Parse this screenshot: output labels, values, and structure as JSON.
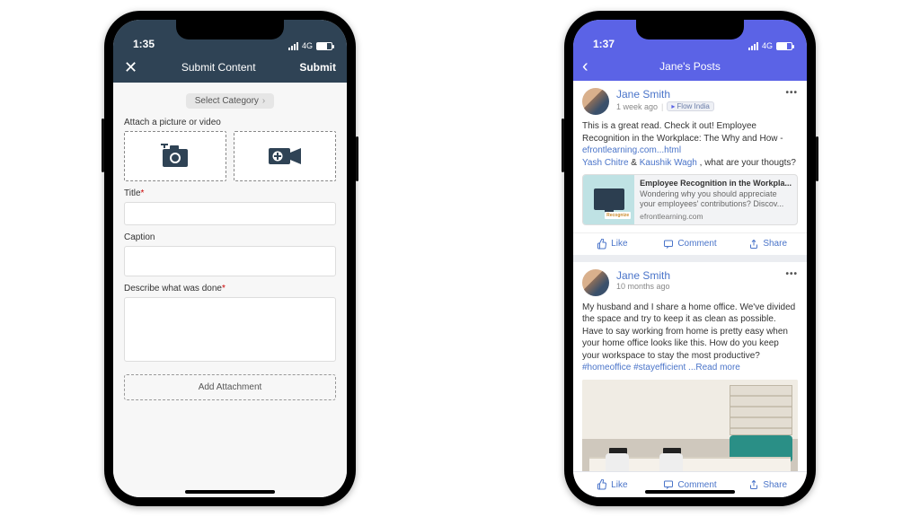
{
  "phone1": {
    "status": {
      "time": "1:35",
      "net": "4G"
    },
    "nav": {
      "title": "Submit Content",
      "submit": "Submit"
    },
    "categoryLabel": "Select Category",
    "attachLabel": "Attach a picture or video",
    "fields": {
      "titleLabel": "Title",
      "captionLabel": "Caption",
      "describeLabel": "Describe what was done"
    },
    "addAttachment": "Add Attachment"
  },
  "phone2": {
    "status": {
      "time": "1:37",
      "net": "4G"
    },
    "nav": {
      "title": "Jane's  Posts"
    },
    "posts": [
      {
        "author": "Jane Smith",
        "timestamp": "1 week ago",
        "tag": "Flow India",
        "bodyPlain1": "This is a great read. Check it out! Employee Recognition in the Workplace: The Why and How - ",
        "link1": "efrontlearning.com...html",
        "mention1": "Yash Chitre",
        "amp": " & ",
        "mention2": "Kaushik Wagh",
        "bodyPlain2": " , what are your thougts?",
        "card": {
          "title": "Employee Recognition in the Workpla...",
          "desc": "Wondering why you should appreciate your employees' contributions? Discov...",
          "source": "efrontlearning.com",
          "badge": "Recognize"
        }
      },
      {
        "author": "Jane Smith",
        "timestamp": "10 months ago",
        "bodyPlain1": "My husband and I share a home office. We've divided the space and try to keep it as clean as possible. Have to say working from home is pretty easy when your home office looks like this. How do you keep your workspace to stay the most productive? ",
        "hashtags": "#homeoffice #stayefficient",
        "readmore": " ...Read more"
      }
    ],
    "actions": {
      "like": "Like",
      "comment": "Comment",
      "share": "Share"
    }
  }
}
